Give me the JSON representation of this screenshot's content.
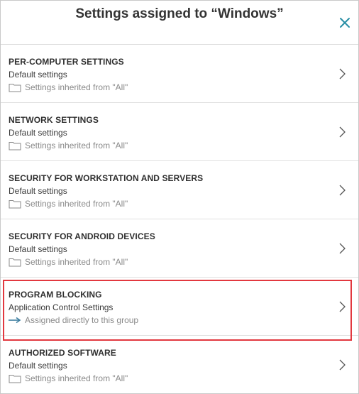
{
  "dialog": {
    "title": "Settings assigned to “Windows”",
    "close_label": "Close"
  },
  "colors": {
    "accent": "#2a8fa6",
    "highlight": "#e2383f",
    "arrow": "#3e7ea0"
  },
  "rows": [
    {
      "title": "PER-COMPUTER SETTINGS",
      "value": "Default settings",
      "meta": "Settings inherited from \"All\"",
      "meta_icon": "folder-icon"
    },
    {
      "title": "NETWORK SETTINGS",
      "value": "Default settings",
      "meta": "Settings inherited from \"All\"",
      "meta_icon": "folder-icon"
    },
    {
      "title": "SECURITY FOR WORKSTATION AND SERVERS",
      "value": "Default settings",
      "meta": "Settings inherited from \"All\"",
      "meta_icon": "folder-icon"
    },
    {
      "title": "SECURITY FOR ANDROID DEVICES",
      "value": "Default settings",
      "meta": "Settings inherited from \"All\"",
      "meta_icon": "folder-icon"
    },
    {
      "title": "PROGRAM BLOCKING",
      "value": "Application Control Settings",
      "meta": "Assigned directly to this group",
      "meta_icon": "arrow-right-icon"
    },
    {
      "title": "AUTHORIZED SOFTWARE",
      "value": "Default settings",
      "meta": "Settings inherited from \"All\"",
      "meta_icon": "folder-icon"
    }
  ]
}
